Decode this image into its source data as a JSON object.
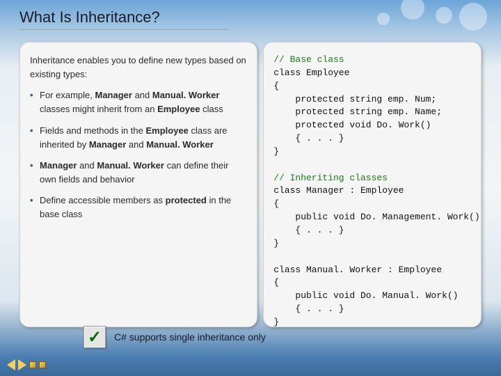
{
  "title": "What Is Inheritance?",
  "intro": "Inheritance enables you to define new types based on existing types:",
  "bullets": [
    {
      "pre": "For example, ",
      "b1": "Manager",
      "mid1": " and ",
      "b2": "Manual. Worker",
      "mid2": " classes might inherit from an ",
      "b3": "Employee",
      "post": " class"
    },
    {
      "pre": "Fields and methods in the ",
      "b1": "Employee",
      "mid1": " class are inherited by ",
      "b2": "Manager",
      "mid2": " and ",
      "b3": "Manual. Worker",
      "post": ""
    },
    {
      "pre": "",
      "b1": "Manager",
      "mid1": " and ",
      "b2": "Manual. Worker",
      "mid2": " can define their own fields and behavior",
      "b3": "",
      "post": ""
    },
    {
      "pre": "Define accessible members as ",
      "b1": "protected",
      "mid1": " in the base class",
      "b2": "",
      "mid2": "",
      "b3": "",
      "post": ""
    }
  ],
  "code": {
    "c1": "// Base class",
    "l2": "class Employee",
    "l3": "{",
    "l4": "    protected string emp. Num;",
    "l5": "    protected string emp. Name;",
    "l6": "    protected void Do. Work()",
    "l7": "    { . . . }",
    "l8": "}",
    "c2": "// Inheriting classes",
    "l10": "class Manager : Employee",
    "l11": "{",
    "l12": "    public void Do. Management. Work()",
    "l13": "    { . . . }",
    "l14": "}",
    "l16": "class Manual. Worker : Employee",
    "l17": "{",
    "l18": "    public void Do. Manual. Work()",
    "l19": "    { . . . }",
    "l20": "}"
  },
  "checkmark": "✓",
  "footer": "C# supports single inheritance only"
}
